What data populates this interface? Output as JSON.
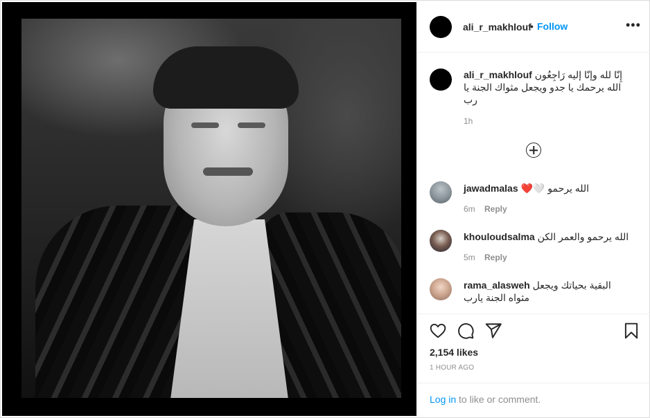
{
  "post": {
    "username": "ali_r_makhlouf",
    "dot": "•",
    "follow_label": "Follow",
    "more_label": "•••"
  },
  "caption": {
    "username": "ali_r_makhlouf",
    "text": "إِنّا لله وإنّا إليه رَاجِعُون  الله يرحمك يا جدو ويجعل مثواك الجنة يا رب",
    "time": "1h"
  },
  "comments": [
    {
      "username": "jawadmalas",
      "text": "الله يرحمو",
      "emoji": "🤍❤️",
      "time": "6m",
      "reply_label": "Reply",
      "avatar": "person-photo"
    },
    {
      "username": "khouloudsalma",
      "text": "الله يرحمو والعمر الكن",
      "time": "5m",
      "reply_label": "Reply",
      "avatar": "person-photo"
    },
    {
      "username": "rama_alasweh",
      "text": "البقية بحياتك ويجعل مثواه الجنة يارب",
      "avatar": "person-photo"
    }
  ],
  "actions": {
    "like_icon": "heart-icon",
    "comment_icon": "comment-bubble-icon",
    "share_icon": "paper-plane-icon",
    "save_icon": "bookmark-icon"
  },
  "likes": "2,154 likes",
  "posted_ago": "1 HOUR AGO",
  "login": {
    "link_label": "Log in",
    "rest": " to like or comment."
  }
}
